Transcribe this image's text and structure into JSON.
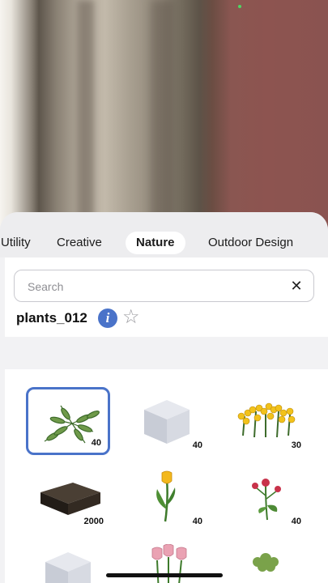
{
  "colors": {
    "accent": "#4a73c9",
    "sheet_bg": "#f2f2f4"
  },
  "tabs": [
    {
      "label": "Utility",
      "active": false
    },
    {
      "label": "Creative",
      "active": false
    },
    {
      "label": "Nature",
      "active": true
    },
    {
      "label": "Outdoor Design",
      "active": false
    }
  ],
  "search": {
    "placeholder": "Search",
    "value": "",
    "clear_icon": "close-icon"
  },
  "selected_asset": {
    "name": "plants_012",
    "info_icon": "info-icon",
    "favorite_icon": "star-outline-icon"
  },
  "assets": [
    {
      "icon": "fern-plant-icon",
      "count": "40",
      "selected": true
    },
    {
      "icon": "placeholder-cube-icon",
      "count": "40",
      "selected": false
    },
    {
      "icon": "yellow-flowers-icon",
      "count": "30",
      "selected": false
    },
    {
      "icon": "soil-block-icon",
      "count": "2000",
      "selected": false
    },
    {
      "icon": "yellow-tulip-icon",
      "count": "40",
      "selected": false
    },
    {
      "icon": "red-flower-icon",
      "count": "40",
      "selected": false
    },
    {
      "icon": "placeholder-cube-icon",
      "count": "",
      "selected": false
    },
    {
      "icon": "pink-tulips-icon",
      "count": "",
      "selected": false
    },
    {
      "icon": "green-shrub-icon",
      "count": "",
      "selected": false
    }
  ]
}
